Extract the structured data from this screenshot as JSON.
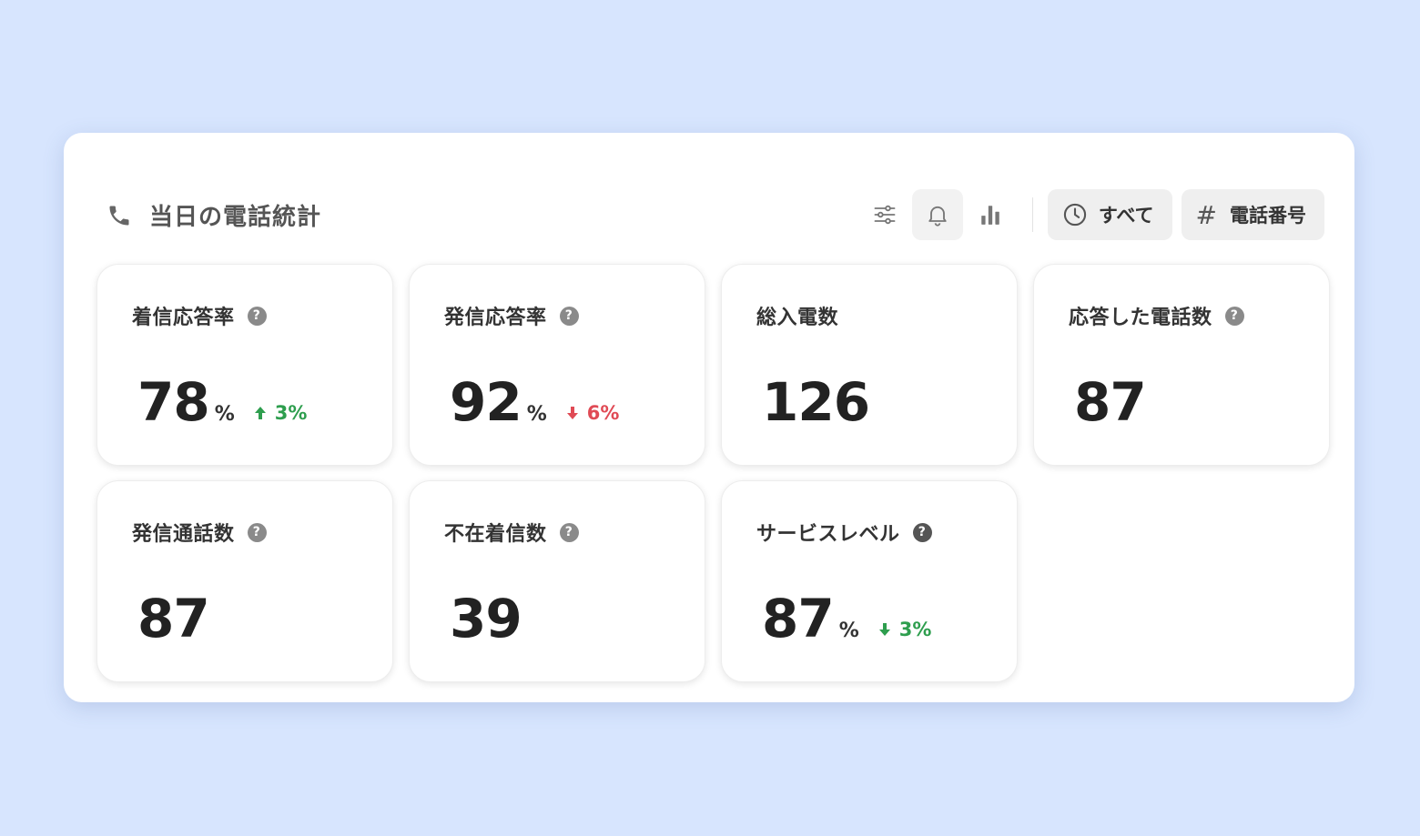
{
  "header": {
    "title": "当日の電話統計",
    "filters": [
      {
        "label": "すべて",
        "icon": "clock-icon"
      },
      {
        "label": "電話番号",
        "icon": "hash-icon",
        "glyph": "#"
      }
    ],
    "icons": [
      "sliders-icon",
      "bell-icon",
      "bar-chart-icon"
    ]
  },
  "cards": [
    {
      "label": "着信応答率",
      "value": "78",
      "unit": "%",
      "delta": "3%",
      "delta_dir": "up",
      "delta_color": "#2e9e4e",
      "help": true
    },
    {
      "label": "発信応答率",
      "value": "92",
      "unit": "%",
      "delta": "6%",
      "delta_dir": "down",
      "delta_color": "#e04a55",
      "help": true
    },
    {
      "label": "総入電数",
      "value": "126",
      "help": false
    },
    {
      "label": "応答した電話数",
      "value": "87",
      "help": true
    },
    {
      "label": "発信通話数",
      "value": "87",
      "help": true
    },
    {
      "label": "不在着信数",
      "value": "39",
      "help": true
    },
    {
      "label": "サービスレベル",
      "value": "87",
      "unit": "%",
      "delta": "3%",
      "delta_dir": "down",
      "delta_color": "#2e9e4e",
      "help": true
    }
  ],
  "help_glyph": "?",
  "colors": {
    "background": "#d7e5fe",
    "panel": "#ffffff",
    "positive": "#2e9e4e",
    "negative": "#e04a55"
  }
}
